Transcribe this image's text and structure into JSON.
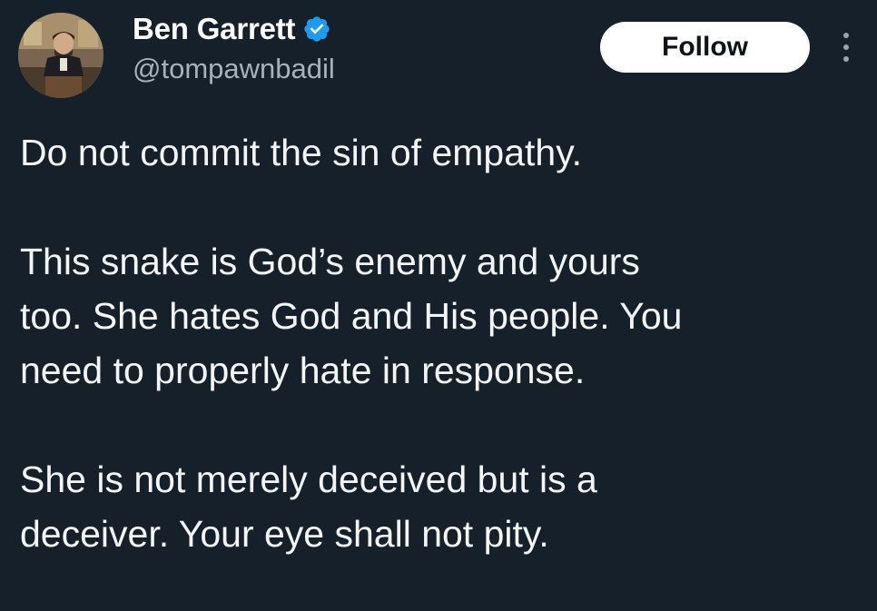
{
  "author": {
    "display_name": "Ben Garrett",
    "handle": "@tompawnbadil",
    "verified": true,
    "avatar_icon": "profile-photo-man-at-podium"
  },
  "actions": {
    "follow_label": "Follow",
    "more_icon": "vertical-ellipsis-icon"
  },
  "tweet": {
    "paragraph_1": "Do not commit the sin of empathy.",
    "paragraph_2_line_1": "This snake is God’s enemy and yours",
    "paragraph_2_line_2": "too. She hates God and His people. You",
    "paragraph_2_line_3": "need to properly hate in response.",
    "paragraph_3_line_1": "She is not merely deceived but is a",
    "paragraph_3_line_2": "deceiver. Your eye shall not pity."
  },
  "colors": {
    "background": "#15202b",
    "text": "#f3f5f6",
    "handle": "#a7b1bb",
    "verified_badge": "#1d9bf0",
    "follow_button_bg": "#ffffff",
    "follow_button_text": "#0f1419"
  }
}
